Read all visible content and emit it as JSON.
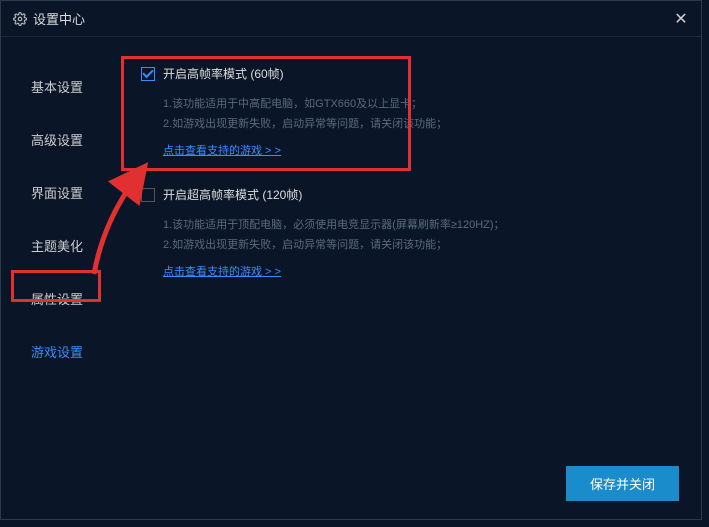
{
  "titlebar": {
    "title": "设置中心"
  },
  "sidebar": {
    "items": [
      {
        "label": "基本设置"
      },
      {
        "label": "高级设置"
      },
      {
        "label": "界面设置"
      },
      {
        "label": "主题美化"
      },
      {
        "label": "属性设置"
      },
      {
        "label": "游戏设置"
      }
    ]
  },
  "options": {
    "highfps": {
      "label": "开启高帧率模式 (60帧)",
      "desc1": "1.该功能适用于中高配电脑，如GTX660及以上显卡；",
      "desc2": "2.如游戏出现更新失败，启动异常等问题，请关闭该功能；",
      "link": "点击查看支持的游戏 > >"
    },
    "ultrafps": {
      "label": "开启超高帧率模式 (120帧)",
      "desc1": "1.该功能适用于顶配电脑，必须使用电竞显示器(屏幕刷新率≥120HZ)；",
      "desc2": "2.如游戏出现更新失败，启动异常等问题，请关闭该功能；",
      "link": "点击查看支持的游戏 > >"
    }
  },
  "footer": {
    "save_label": "保存并关闭"
  }
}
